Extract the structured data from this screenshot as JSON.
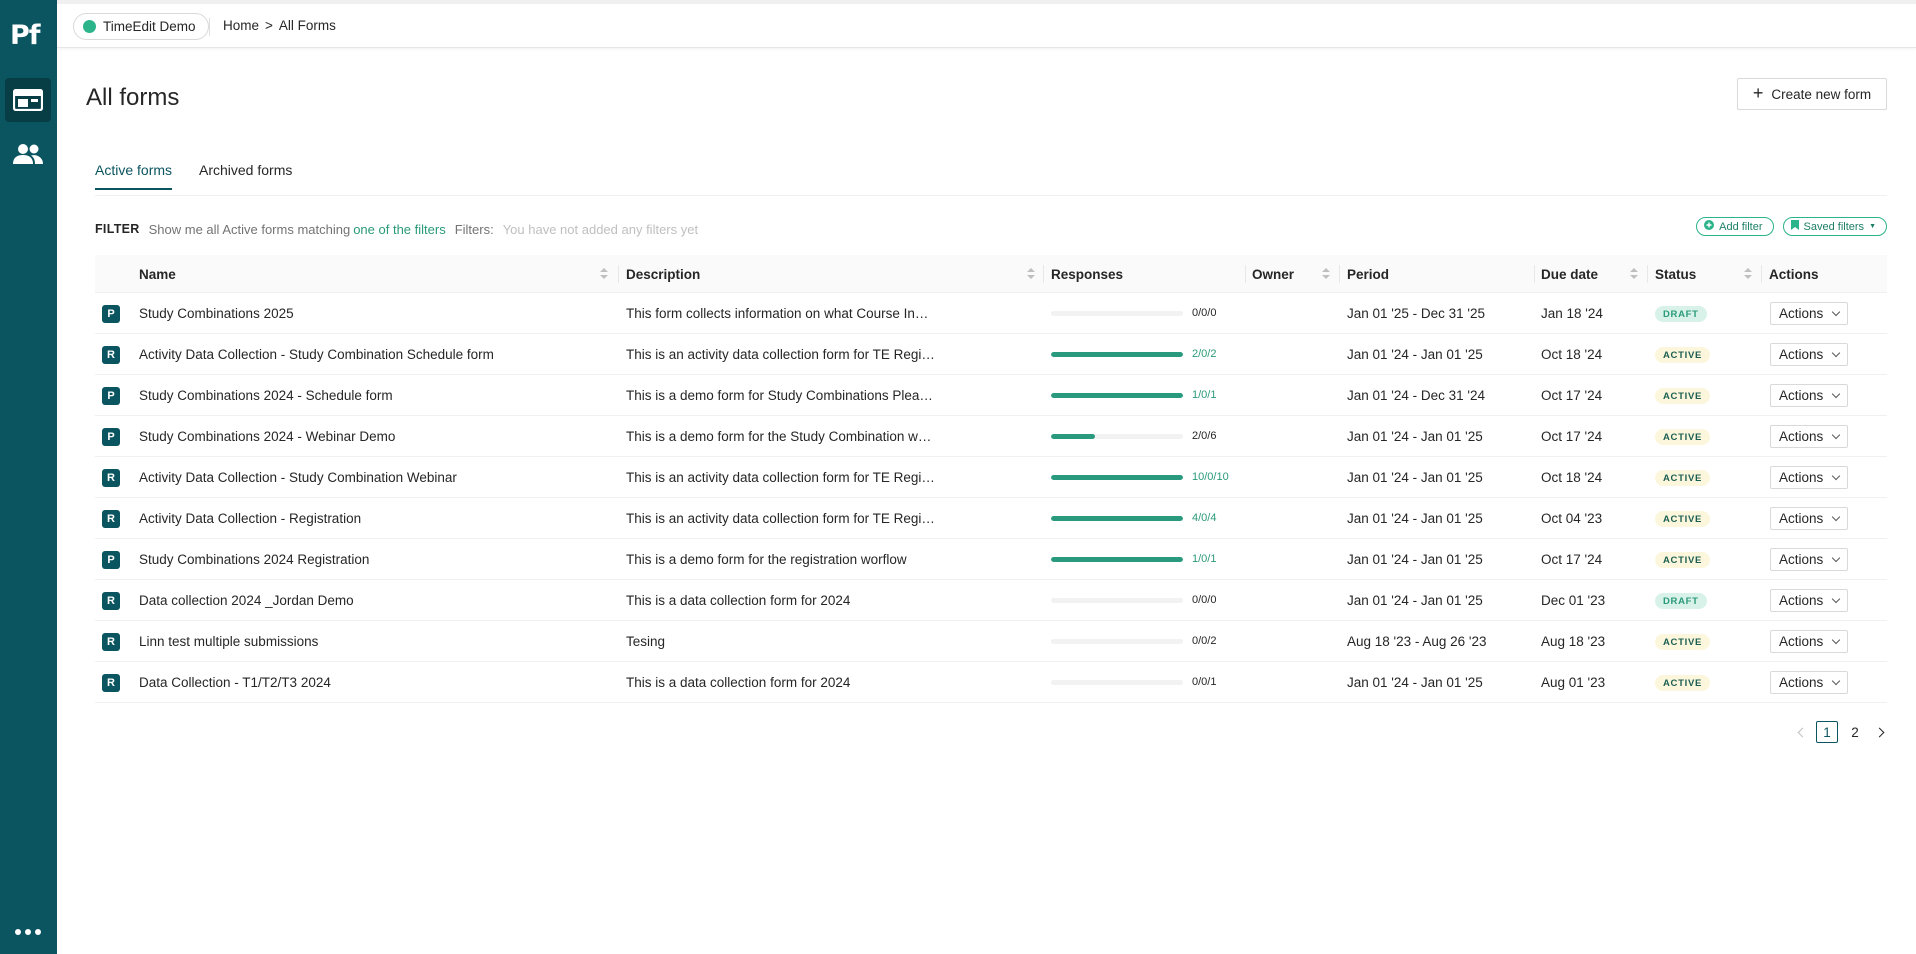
{
  "app": {
    "logo": "Pf"
  },
  "topbar": {
    "org": "TimeEdit Demo",
    "breadcrumb": {
      "home": "Home",
      "sep": ">",
      "current": "All Forms"
    }
  },
  "page": {
    "title": "All forms",
    "create_button": "Create new form"
  },
  "tabs": [
    {
      "label": "Active forms",
      "active": true
    },
    {
      "label": "Archived forms",
      "active": false
    }
  ],
  "filter": {
    "label": "FILTER",
    "text": "Show me all Active forms matching",
    "match_link": "one of the filters",
    "filters_label": "Filters:",
    "empty": "You have not added any filters yet",
    "add_filter": "Add filter",
    "saved_filters": "Saved filters"
  },
  "table": {
    "columns": {
      "name": "Name",
      "description": "Description",
      "responses": "Responses",
      "owner": "Owner",
      "period": "Period",
      "due_date": "Due date",
      "status": "Status",
      "actions": "Actions"
    },
    "rows": [
      {
        "type": "P",
        "name": "Study Combinations 2025",
        "description": "This form collects information on what Course In…",
        "progress": 0,
        "responses": "0/0/0",
        "owner": "",
        "period": "Jan 01 '25 - Dec 31 '25",
        "due": "Jan 18 '24",
        "status": "DRAFT",
        "actions": "Actions"
      },
      {
        "type": "R",
        "name": "Activity Data Collection - Study Combination Schedule form",
        "description": "This is an activity data collection form for TE Regi…",
        "progress": 1,
        "responses": "2/0/2",
        "owner": "",
        "period": "Jan 01 '24 - Jan 01 '25",
        "due": "Oct 18 '24",
        "status": "ACTIVE",
        "actions": "Actions"
      },
      {
        "type": "P",
        "name": "Study Combinations 2024 - Schedule form",
        "description": "This is a demo form for Study Combinations Plea…",
        "progress": 1,
        "responses": "1/0/1",
        "owner": "",
        "period": "Jan 01 '24 - Dec 31 '24",
        "due": "Oct 17 '24",
        "status": "ACTIVE",
        "actions": "Actions"
      },
      {
        "type": "P",
        "name": "Study Combinations 2024 - Webinar Demo",
        "description": "This is a demo form for the Study Combination w…",
        "progress": 0.33,
        "responses": "2/0/6",
        "owner": "",
        "period": "Jan 01 '24 - Jan 01 '25",
        "due": "Oct 17 '24",
        "status": "ACTIVE",
        "actions": "Actions"
      },
      {
        "type": "R",
        "name": "Activity Data Collection - Study Combination Webinar",
        "description": "This is an activity data collection form for TE Regi…",
        "progress": 1,
        "responses": "10/0/10",
        "owner": "",
        "period": "Jan 01 '24 - Jan 01 '25",
        "due": "Oct 18 '24",
        "status": "ACTIVE",
        "actions": "Actions"
      },
      {
        "type": "R",
        "name": "Activity Data Collection - Registration",
        "description": "This is an activity data collection form for TE Regi…",
        "progress": 1,
        "responses": "4/0/4",
        "owner": "",
        "period": "Jan 01 '24 - Jan 01 '25",
        "due": "Oct 04 '23",
        "status": "ACTIVE",
        "actions": "Actions"
      },
      {
        "type": "P",
        "name": "Study Combinations 2024 Registration",
        "description": "This is a demo form for the registration worflow",
        "progress": 1,
        "responses": "1/0/1",
        "owner": "",
        "period": "Jan 01 '24 - Jan 01 '25",
        "due": "Oct 17 '24",
        "status": "ACTIVE",
        "actions": "Actions"
      },
      {
        "type": "R",
        "name": "Data collection 2024 _Jordan Demo",
        "description": "This is a data collection form for 2024",
        "progress": 0,
        "responses": "0/0/0",
        "owner": "",
        "period": "Jan 01 '24 - Jan 01 '25",
        "due": "Dec 01 '23",
        "status": "DRAFT",
        "actions": "Actions"
      },
      {
        "type": "R",
        "name": "Linn test multiple submissions",
        "description": "Tesing",
        "progress": 0,
        "responses": "0/0/2",
        "owner": "",
        "period": "Aug 18 '23 - Aug 26 '23",
        "due": "Aug 18 '23",
        "status": "ACTIVE",
        "actions": "Actions"
      },
      {
        "type": "R",
        "name": "Data Collection - T1/T2/T3 2024",
        "description": "This is a data collection form for 2024",
        "progress": 0,
        "responses": "0/0/1",
        "owner": "",
        "period": "Jan 01 '24 - Jan 01 '25",
        "due": "Aug 01 '23",
        "status": "ACTIVE",
        "actions": "Actions"
      }
    ]
  },
  "pagination": {
    "pages": [
      "1",
      "2"
    ],
    "current": "1"
  },
  "colors": {
    "brand": "#0b5560",
    "accent": "#2bb38a",
    "progress": "#2a9a7e"
  },
  "icons": {
    "forms": "forms-icon",
    "users": "users-icon",
    "more": "more-icon"
  }
}
